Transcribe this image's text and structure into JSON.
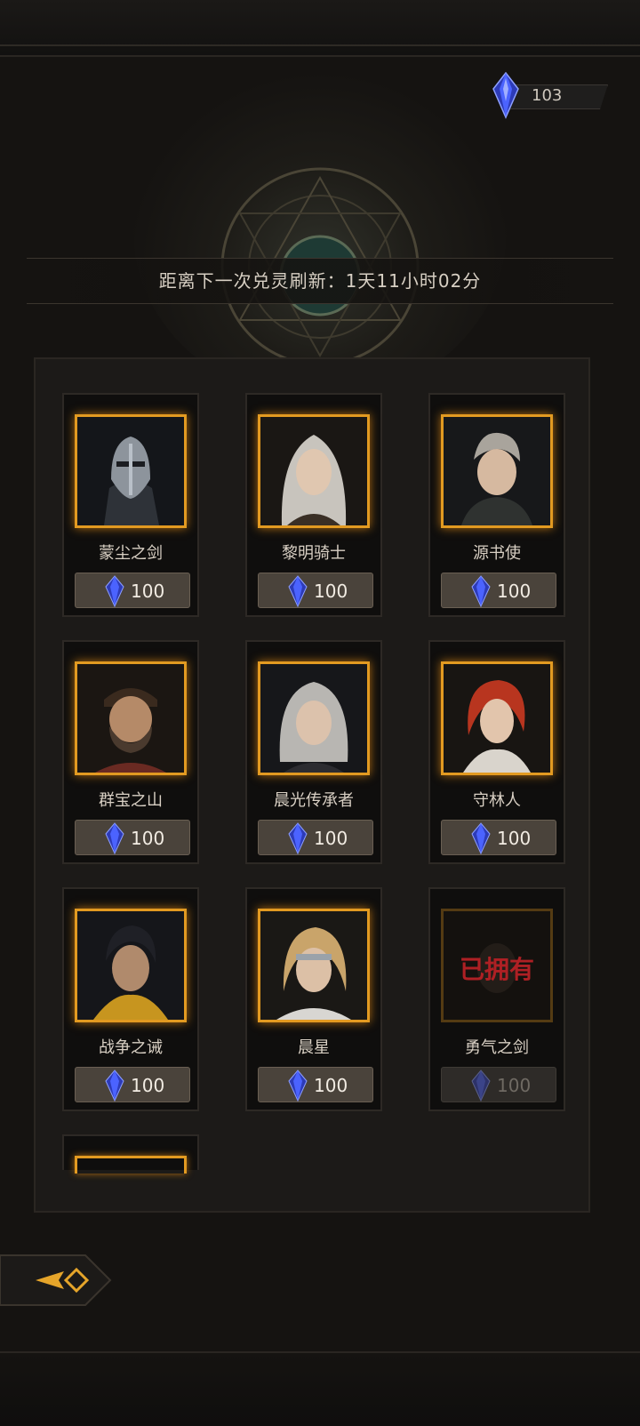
{
  "currency": {
    "icon": "crystal-icon",
    "amount": "103"
  },
  "refresh": {
    "text": "距离下一次兑灵刷新：1天11小时02分"
  },
  "colors": {
    "gold_frame": "#e29a21",
    "owned_red": "#e3262c",
    "crystal": "#3a4fe0"
  },
  "cards": [
    {
      "name": "蒙尘之剑",
      "price": "100",
      "owned": false
    },
    {
      "name": "黎明骑士",
      "price": "100",
      "owned": false
    },
    {
      "name": "源书使",
      "price": "100",
      "owned": false
    },
    {
      "name": "群宝之山",
      "price": "100",
      "owned": false
    },
    {
      "name": "晨光传承者",
      "price": "100",
      "owned": false
    },
    {
      "name": "守林人",
      "price": "100",
      "owned": false
    },
    {
      "name": "战争之诫",
      "price": "100",
      "owned": false
    },
    {
      "name": "晨星",
      "price": "100",
      "owned": false
    },
    {
      "name": "勇气之剑",
      "price": "100",
      "owned": true,
      "owned_label": "已拥有"
    }
  ],
  "back_button": {
    "icon": "back-arrow-icon"
  }
}
